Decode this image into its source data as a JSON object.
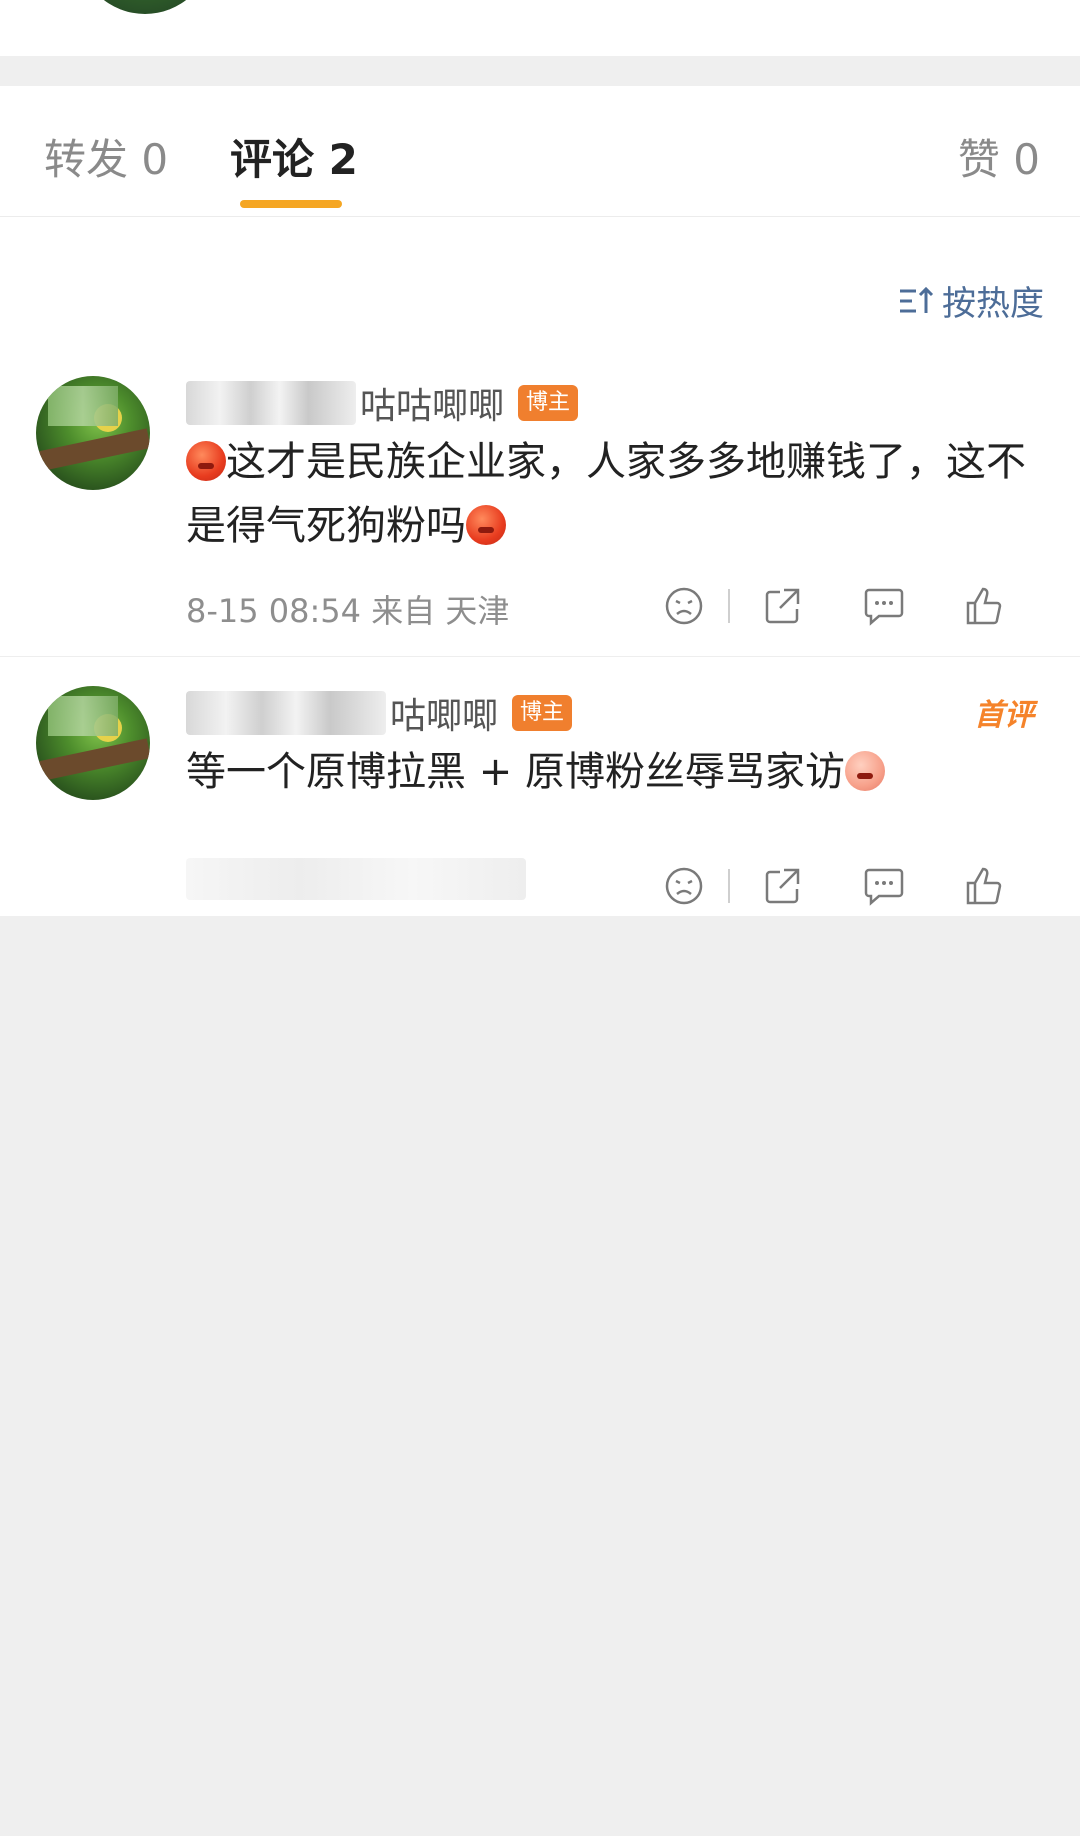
{
  "tabs": {
    "repost": "转发 0",
    "comment": "评论 2",
    "like": "赞 0"
  },
  "sort": {
    "label": "按热度"
  },
  "comments": [
    {
      "name_visible": "咕咕唧唧",
      "badge": "博主",
      "text_main": "这才是民族企业家，人家多多地赚钱了，这不是得气死狗粉吗",
      "meta": "8-15 08:54  来自 天津"
    },
    {
      "name_visible": "咕唧唧",
      "badge": "博主",
      "first_label": "首评",
      "text_main": "等一个原博拉黑 + 原博粉丝辱骂家访"
    }
  ],
  "icons": {
    "dislike": "sad-face-icon",
    "share": "share-icon",
    "reply": "comment-icon",
    "like": "thumbs-up-icon",
    "sort": "sort-icon"
  },
  "colors": {
    "accent": "#f5a623",
    "badge": "#f07f2e",
    "link": "#4d6d98"
  }
}
